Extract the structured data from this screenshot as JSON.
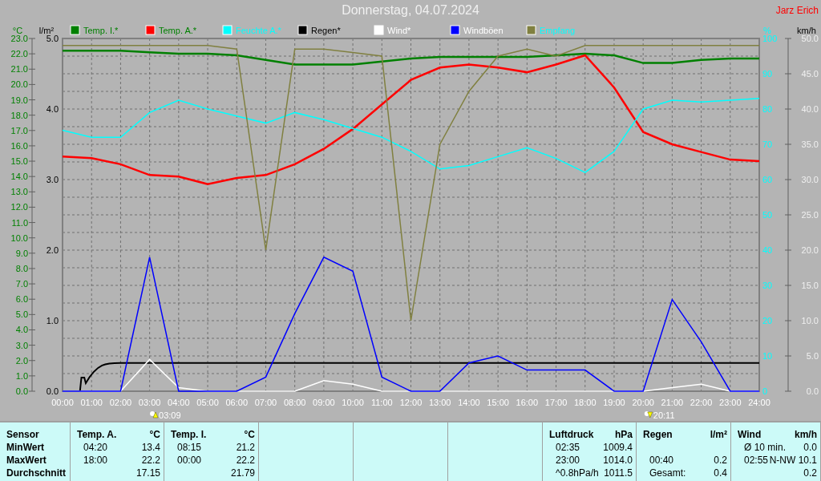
{
  "title": "Donnerstag, 04.07.2024",
  "author": "Jarz Erich",
  "chart": {
    "legend_entries": [
      {
        "label": "Temp. I.*",
        "color": "#008000"
      },
      {
        "label": "Temp. A.*",
        "color": "#ff0000"
      },
      {
        "label": "Feuchte A.*",
        "color": "#00ffff"
      },
      {
        "label": "Regen*",
        "color": "#000000"
      },
      {
        "label": "Wind*",
        "color": "#ffffff"
      },
      {
        "label": "Windböen",
        "color": "#0000ff"
      },
      {
        "label": "Empfang",
        "color": "#808040"
      }
    ],
    "axes": [
      {
        "unit": "°C"
      },
      {
        "unit": "l/m²",
        "ticks": [
          "5.0",
          "4.0",
          "3.0",
          "2.0",
          "1.0",
          "0.0"
        ]
      },
      {
        "unit": "%"
      },
      {
        "unit": "km/h"
      }
    ],
    "chart_data": {
      "type": "line",
      "grid": true,
      "categories": [
        "00:00",
        "01:00",
        "02:00",
        "03:00",
        "04:00",
        "05:00",
        "06:00",
        "07:00",
        "08:00",
        "09:00",
        "10:00",
        "11:00",
        "12:00",
        "13:00",
        "14:00",
        "15:00",
        "16:00",
        "17:00",
        "18:00",
        "19:00",
        "20:00",
        "21:00",
        "22:00",
        "23:00",
        "24:00"
      ],
      "ylim": [
        0,
        23
      ],
      "yticks": [
        {
          "value": 0,
          "label": "0.0"
        },
        {
          "value": 1,
          "label": "1.0"
        },
        {
          "value": 2,
          "label": "2.0"
        },
        {
          "value": 3,
          "label": "3.0"
        },
        {
          "value": 4,
          "label": "4.0"
        },
        {
          "value": 5,
          "label": "5.0"
        },
        {
          "value": 6,
          "label": "6.0"
        },
        {
          "value": 7,
          "label": "7.0"
        },
        {
          "value": 8,
          "label": "8.0"
        },
        {
          "value": 9,
          "label": "9.0"
        },
        {
          "value": 10,
          "label": "10.0"
        },
        {
          "value": 11,
          "label": "11.0"
        },
        {
          "value": 12,
          "label": "12.0"
        },
        {
          "value": 13,
          "label": "13.0"
        },
        {
          "value": 14,
          "label": "14.0"
        },
        {
          "value": 15,
          "label": "15.0"
        },
        {
          "value": 16,
          "label": "16.0"
        },
        {
          "value": 17,
          "label": "17.0"
        },
        {
          "value": 18,
          "label": "18.0"
        },
        {
          "value": 19,
          "label": "19.0"
        },
        {
          "value": 20,
          "label": "20.0"
        },
        {
          "value": 21,
          "label": "21.0"
        },
        {
          "value": 22,
          "label": "22.0"
        },
        {
          "value": 23,
          "label": "23.0"
        }
      ],
      "y2lim": [
        0,
        100
      ],
      "y2ticks": [
        {
          "value": 0,
          "label": "0"
        },
        {
          "value": 10,
          "label": "10"
        },
        {
          "value": 20,
          "label": "20"
        },
        {
          "value": 30,
          "label": "30"
        },
        {
          "value": 40,
          "label": "40"
        },
        {
          "value": 50,
          "label": "50"
        },
        {
          "value": 60,
          "label": "60"
        },
        {
          "value": 70,
          "label": "70"
        },
        {
          "value": 80,
          "label": "80"
        },
        {
          "value": 90,
          "label": "90"
        },
        {
          "value": 100,
          "label": "100"
        }
      ],
      "y3lim": [
        0,
        50
      ],
      "y3ticks": [
        {
          "value": 0,
          "label": "0.0"
        },
        {
          "value": 5,
          "label": "5.0"
        },
        {
          "value": 10,
          "label": "10.0"
        },
        {
          "value": 15,
          "label": "15.0"
        },
        {
          "value": 20,
          "label": "20.0"
        },
        {
          "value": 25,
          "label": "25.0"
        },
        {
          "value": 30,
          "label": "30.0"
        },
        {
          "value": 35,
          "label": "35.0"
        },
        {
          "value": 40,
          "label": "40.0"
        },
        {
          "value": 45,
          "label": "45.0"
        },
        {
          "value": 50,
          "label": "50.0"
        }
      ],
      "series": [
        {
          "color": "#008000",
          "values": [
            22.2,
            22.2,
            22.2,
            22.1,
            22.0,
            22.0,
            21.9,
            21.6,
            21.3,
            21.3,
            21.3,
            21.5,
            21.7,
            21.8,
            21.8,
            21.8,
            21.8,
            21.9,
            22.0,
            21.9,
            21.4,
            21.4,
            21.6,
            21.7,
            21.7
          ]
        },
        {
          "color": "#ff0000",
          "values": [
            15.3,
            15.2,
            14.8,
            14.1,
            14.0,
            13.5,
            13.9,
            14.1,
            14.8,
            15.8,
            17.1,
            18.7,
            20.3,
            21.1,
            21.3,
            21.1,
            20.8,
            21.3,
            21.9,
            19.8,
            16.9,
            16.1,
            15.6,
            15.1,
            15.0
          ]
        },
        {
          "color": "#00ffff",
          "axis": "y2",
          "values": [
            74,
            72,
            72,
            79,
            82.5,
            80,
            78,
            76,
            79,
            77,
            74.5,
            72,
            68,
            63,
            64,
            66.5,
            69,
            66,
            62,
            68,
            80,
            82.5,
            82,
            82.5,
            83
          ]
        },
        {
          "color": "#ffffff",
          "axis": "y3",
          "values": [
            0,
            0,
            0,
            4.5,
            0.5,
            0,
            0,
            0,
            0,
            1.5,
            1.0,
            0,
            0,
            0,
            0,
            0,
            0,
            0,
            0,
            0,
            0,
            0.5,
            1.0,
            0,
            0
          ]
        },
        {
          "color": "#0000ff",
          "axis": "y3",
          "values": [
            0,
            0,
            0,
            19,
            0,
            0,
            0,
            2,
            11,
            19,
            17,
            2,
            0,
            0,
            4,
            5,
            3,
            3,
            3,
            0,
            0,
            13,
            7,
            0,
            0
          ]
        },
        {
          "color": "#808040",
          "axis": "y2",
          "values": [
            98,
            98,
            98,
            98,
            98,
            98,
            97,
            40,
            97,
            97,
            96,
            95,
            20,
            70,
            85,
            95,
            97,
            95,
            98,
            98,
            98,
            98,
            98,
            98,
            98
          ]
        }
      ]
    },
    "sun_events": [
      {
        "kind": "sunrise",
        "time": "03:09"
      },
      {
        "kind": "sunset",
        "time": "20:11"
      }
    ]
  },
  "table": {
    "row_labels": [
      "Sensor",
      "MinWert",
      "MaxWert",
      "Durchschnitt"
    ],
    "columns": [
      {
        "kind": "values",
        "title": "Temp. A.",
        "unit": "°C",
        "rows": [
          {
            "time": "04:20",
            "value": "13.4"
          },
          {
            "time": "18:00",
            "value": "22.2"
          },
          {
            "value": "17.15"
          }
        ]
      },
      {
        "kind": "values",
        "title": "Temp. I.",
        "unit": "°C",
        "rows": [
          {
            "time": "08:15",
            "value": "21.2"
          },
          {
            "time": "00:00",
            "value": "22.2"
          },
          {
            "value": "21.79"
          }
        ]
      },
      {
        "kind": "blank"
      },
      {
        "kind": "blank"
      },
      {
        "kind": "blank"
      },
      {
        "kind": "values",
        "title": "Luftdruck",
        "unit": "hPa",
        "rows": [
          {
            "time": "02:35",
            "value": "1009.4"
          },
          {
            "time": "23:00",
            "value": "1014.0"
          },
          {
            "time": "^0.8hPa/h",
            "value": "1011.5"
          }
        ]
      },
      {
        "kind": "values",
        "title": "Regen",
        "unit": "l/m²",
        "rows": [
          {},
          {
            "time": "00:40",
            "value": "0.2"
          },
          {
            "time": "Gesamt:",
            "value": "0.4"
          }
        ]
      },
      {
        "kind": "values",
        "title": "Wind",
        "unit": "km/h",
        "rows": [
          {
            "time": "Ø 10 min.",
            "value": "0.0"
          },
          {
            "time": "02:55",
            "value": "N-NW 10.1"
          },
          {
            "value": "0.2"
          }
        ]
      }
    ]
  }
}
